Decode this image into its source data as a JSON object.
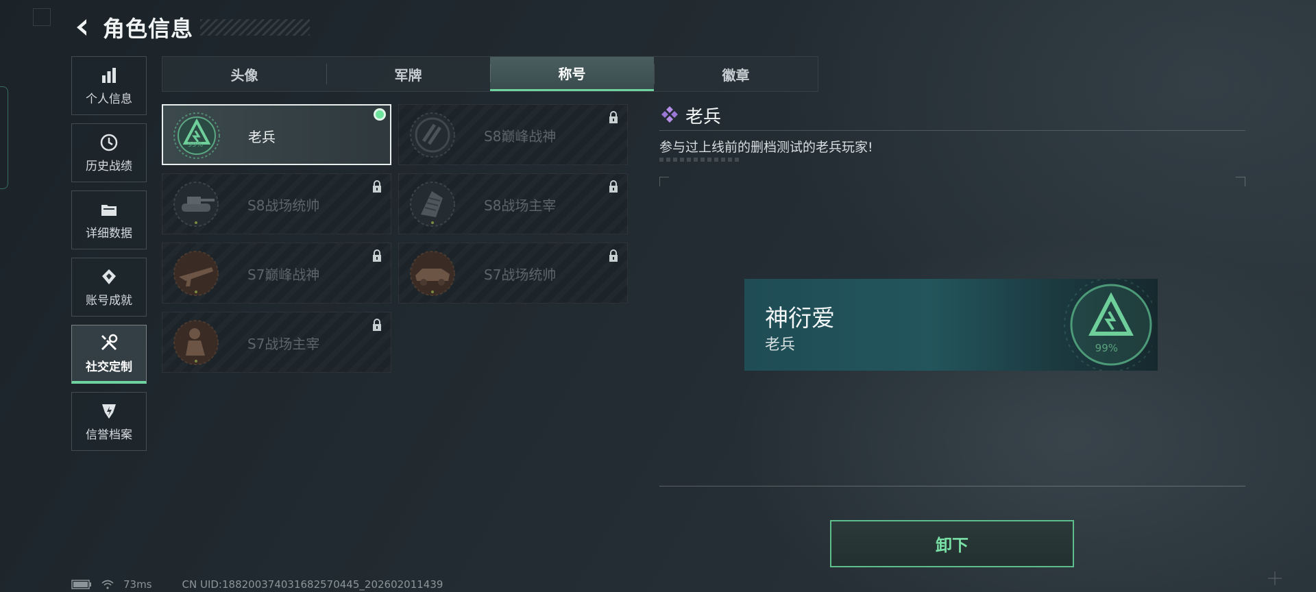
{
  "header": {
    "title": "角色信息"
  },
  "sidebar": {
    "items": [
      {
        "label": "个人信息",
        "icon": "bar-chart-icon"
      },
      {
        "label": "历史战绩",
        "icon": "history-icon"
      },
      {
        "label": "详细数据",
        "icon": "folder-icon"
      },
      {
        "label": "账号成就",
        "icon": "achievement-icon"
      },
      {
        "label": "社交定制",
        "icon": "tools-icon",
        "active": true
      },
      {
        "label": "信誉档案",
        "icon": "shield-icon"
      }
    ]
  },
  "tabs": [
    {
      "label": "头像"
    },
    {
      "label": "军牌"
    },
    {
      "label": "称号",
      "active": true
    },
    {
      "label": "徽章"
    }
  ],
  "titles": [
    {
      "name": "老兵",
      "selected": true,
      "equipped": true,
      "locked": false,
      "emblem_pct": "99%"
    },
    {
      "name": "S8巅峰战神",
      "locked": true
    },
    {
      "name": "S8战场统帅",
      "locked": true
    },
    {
      "name": "S8战场主宰",
      "locked": true
    },
    {
      "name": "S7巅峰战神",
      "locked": true
    },
    {
      "name": "S7战场统帅",
      "locked": true
    },
    {
      "name": "S7战场主宰",
      "locked": true
    }
  ],
  "detail": {
    "title": "老兵",
    "description": "参与过上线前的删档测试的老兵玩家!"
  },
  "preview": {
    "player_name": "神衍爱",
    "title": "老兵",
    "emblem_pct": "99%"
  },
  "actions": {
    "unequip_label": "卸下"
  },
  "status": {
    "ping": "73ms",
    "uid": "CN UID:188200374031682570445_202602011439"
  },
  "colors": {
    "accent": "#6fd3a0",
    "preview_bg": "#23555c",
    "equipped_dot": "#6ee39c"
  }
}
